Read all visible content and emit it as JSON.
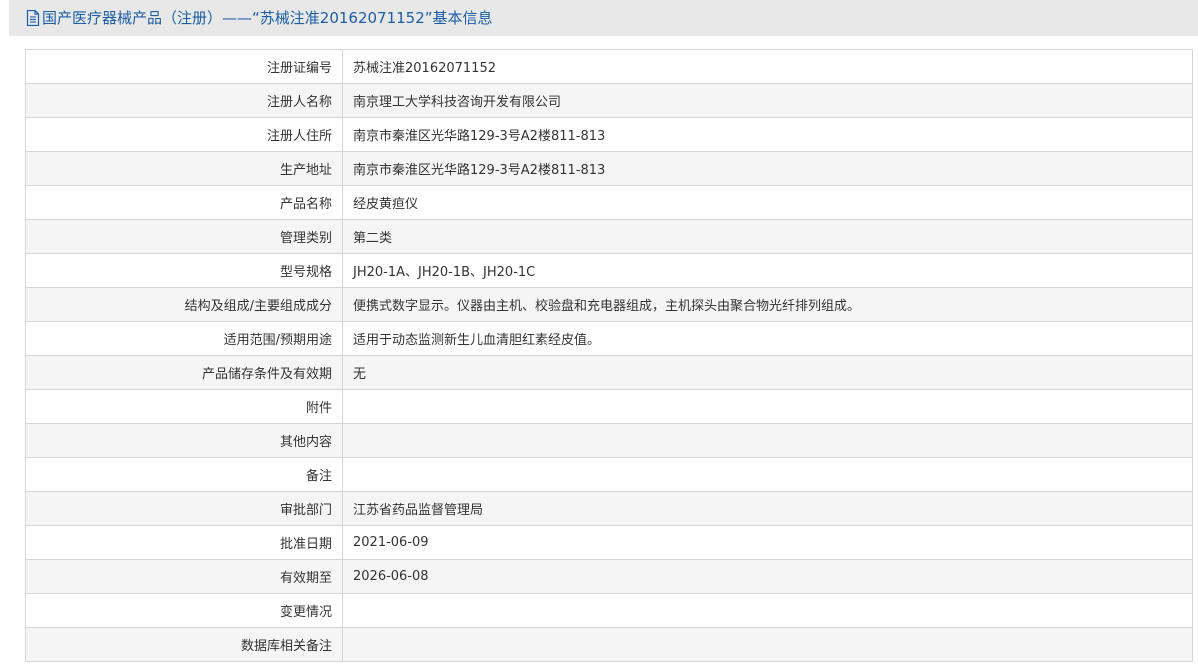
{
  "header": {
    "title": "国产医疗器械产品（注册）——“苏械注准20162071152”基本信息"
  },
  "rows": [
    {
      "label": "注册证编号",
      "value": "苏械注准20162071152"
    },
    {
      "label": "注册人名称",
      "value": "南京理工大学科技咨询开发有限公司"
    },
    {
      "label": "注册人住所",
      "value": "南京市秦淮区光华路129-3号A2楼811-813"
    },
    {
      "label": "生产地址",
      "value": "南京市秦淮区光华路129-3号A2楼811-813"
    },
    {
      "label": "产品名称",
      "value": "经皮黄疸仪"
    },
    {
      "label": "管理类别",
      "value": "第二类"
    },
    {
      "label": "型号规格",
      "value": "JH20-1A、JH20-1B、JH20-1C"
    },
    {
      "label": "结构及组成/主要组成成分",
      "value": "便携式数字显示。仪器由主机、校验盘和充电器组成，主机探头由聚合物光纤排列组成。"
    },
    {
      "label": "适用范围/预期用途",
      "value": "适用于动态监测新生儿血清胆红素经皮值。"
    },
    {
      "label": "产品储存条件及有效期",
      "value": "无"
    },
    {
      "label": "附件",
      "value": ""
    },
    {
      "label": "其他内容",
      "value": ""
    },
    {
      "label": "备注",
      "value": ""
    },
    {
      "label": "审批部门",
      "value": "江苏省药品监督管理局"
    },
    {
      "label": "批准日期",
      "value": "2021-06-09"
    },
    {
      "label": "有效期至",
      "value": "2026-06-08"
    },
    {
      "label": "变更情况",
      "value": ""
    },
    {
      "label": "数据库相关备注",
      "value": ""
    }
  ],
  "colors": {
    "title_text": "#1a5da8",
    "title_bar_bg": "#e8e8e8",
    "row_alt_bg": "#f5f5f5",
    "border": "#d6d6d6"
  },
  "icons": {
    "title_icon": "document-icon"
  }
}
